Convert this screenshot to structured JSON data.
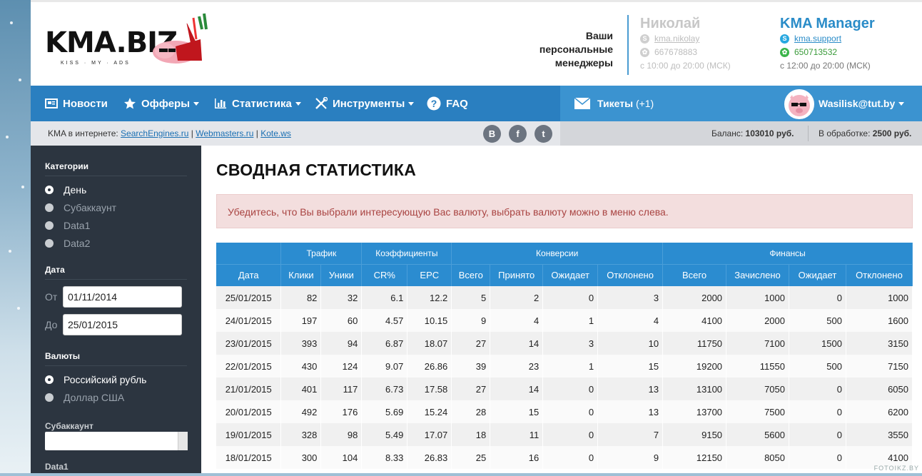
{
  "logo": {
    "word": "KMA.BIZ",
    "tagline": "KISS · MY · ADS"
  },
  "managers": {
    "label": "Ваши персональные менеджеры",
    "manager1": {
      "name": "Николай",
      "skype": "kma.nikolay",
      "icq": "667678883",
      "hours": "с 10:00 до 20:00 (МСК)"
    },
    "manager2": {
      "name": "KMA Manager",
      "skype": "kma.support",
      "icq": "650713532",
      "hours": "с 12:00 до 20:00 (МСК)"
    }
  },
  "nav": {
    "news": "Новости",
    "offers": "Офферы",
    "stats": "Статистика",
    "tools": "Инструменты",
    "faq": "FAQ",
    "tickets": "Тикеты",
    "tickets_count": "(+1)",
    "user": "Wasilisk@tut.by"
  },
  "subbar": {
    "prefix": "KMA в интернете:",
    "link1": "SearchEngines.ru",
    "link2": "Webmasters.ru",
    "link3": "Kote.ws",
    "divider": "|",
    "social": [
      "В",
      "f",
      "t"
    ],
    "balance_label": "Баланс:",
    "balance_value": "103010 руб.",
    "processing_label": "В обработке:",
    "processing_value": "2500 руб."
  },
  "sidebar": {
    "categories_title": "Категории",
    "categories": [
      "День",
      "Субаккаунт",
      "Data1",
      "Data2"
    ],
    "date_title": "Дата",
    "from_label": "От",
    "from_value": "01/11/2014",
    "to_label": "До",
    "to_value": "25/01/2015",
    "currency_title": "Валюты",
    "currencies": [
      "Российский рубль",
      "Доллар США"
    ],
    "subaccount_title": "Субаккаунт",
    "data1_title": "Data1"
  },
  "main": {
    "title": "СВОДНАЯ СТАТИСТИКА",
    "alert": "Убедитесь, что Вы выбрали интересующую Вас валюту, выбрать валюту можно в меню слева.",
    "groups": [
      "Трафик",
      "Коэффициенты",
      "Конверсии",
      "Финансы"
    ],
    "columns": [
      "Дата",
      "Клики",
      "Уники",
      "CR%",
      "EPC",
      "Всего",
      "Принято",
      "Ожидает",
      "Отклонено",
      "Всего",
      "Зачислено",
      "Ожидает",
      "Отклонено"
    ],
    "rows": [
      [
        "25/01/2015",
        "82",
        "32",
        "6.1",
        "12.2",
        "5",
        "2",
        "0",
        "3",
        "2000",
        "1000",
        "0",
        "1000"
      ],
      [
        "24/01/2015",
        "197",
        "60",
        "4.57",
        "10.15",
        "9",
        "4",
        "1",
        "4",
        "4100",
        "2000",
        "500",
        "1600"
      ],
      [
        "23/01/2015",
        "393",
        "94",
        "6.87",
        "18.07",
        "27",
        "14",
        "3",
        "10",
        "11750",
        "7100",
        "1500",
        "3150"
      ],
      [
        "22/01/2015",
        "430",
        "124",
        "9.07",
        "26.86",
        "39",
        "23",
        "1",
        "15",
        "19200",
        "11550",
        "500",
        "7150"
      ],
      [
        "21/01/2015",
        "401",
        "117",
        "6.73",
        "17.58",
        "27",
        "14",
        "0",
        "13",
        "13100",
        "7050",
        "0",
        "6050"
      ],
      [
        "20/01/2015",
        "492",
        "176",
        "5.69",
        "15.24",
        "28",
        "15",
        "0",
        "13",
        "13700",
        "7500",
        "0",
        "6200"
      ],
      [
        "19/01/2015",
        "328",
        "98",
        "5.49",
        "17.07",
        "18",
        "11",
        "0",
        "7",
        "9150",
        "5600",
        "0",
        "3550"
      ],
      [
        "18/01/2015",
        "300",
        "104",
        "8.33",
        "26.83",
        "25",
        "16",
        "0",
        "9",
        "12150",
        "8050",
        "0",
        "4100"
      ]
    ]
  },
  "watermark": "FOTOIKZ.BY",
  "colors": {
    "nav": "#2a7fc0",
    "nav_right": "#3b93d0",
    "sidebar": "#2c3540",
    "table_header": "#2b8cd0",
    "alert_bg": "#f3dede",
    "alert_text": "#a94442"
  }
}
